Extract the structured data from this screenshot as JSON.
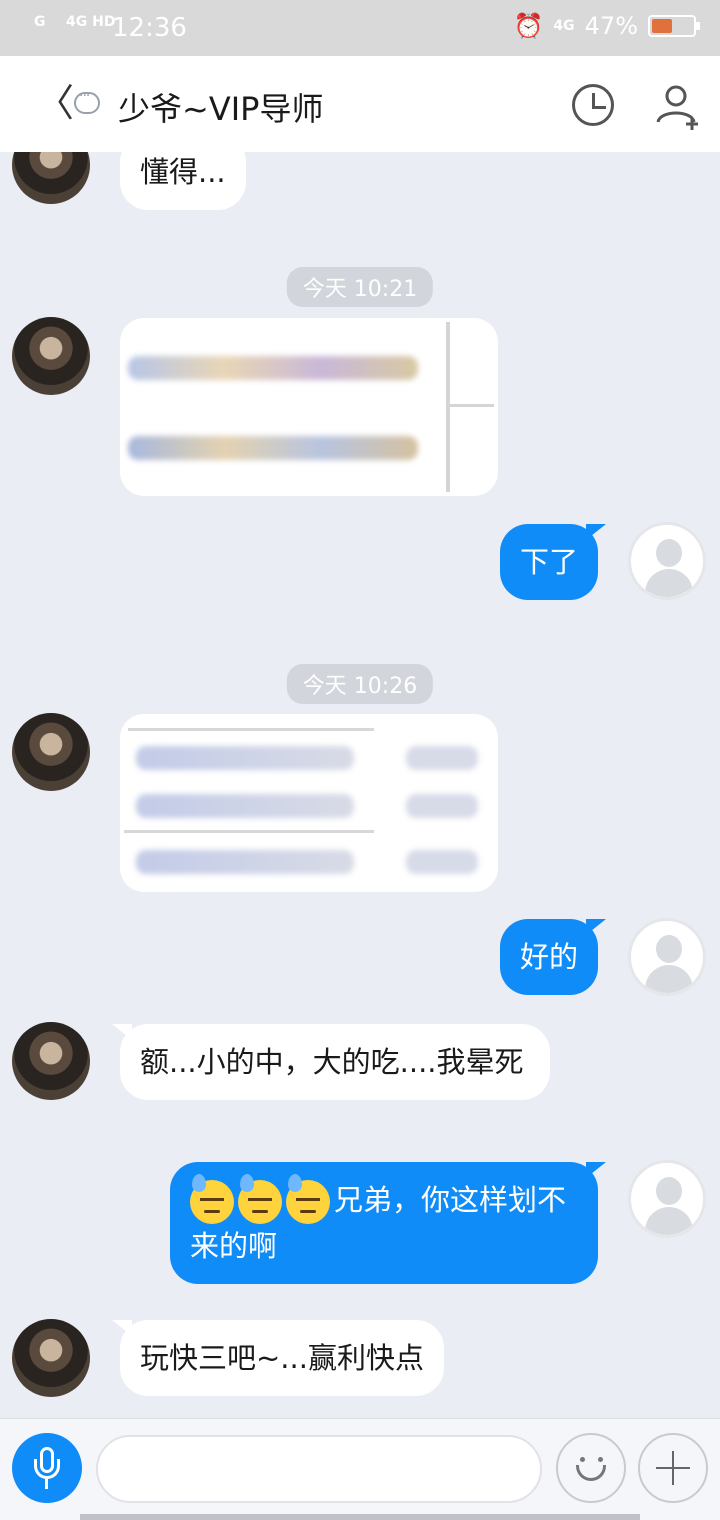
{
  "status_bar": {
    "signal_1": "G",
    "signal_2": "4G HD",
    "time": "12:36",
    "network": "4G",
    "battery": "47%"
  },
  "nav": {
    "title": "少爷~VIP导师"
  },
  "messages": [
    {
      "text": "懂得..."
    },
    {
      "timestamp": "今天 10:21"
    },
    {
      "text": "下了"
    },
    {
      "timestamp": "今天 10:26"
    },
    {
      "text": "好的"
    },
    {
      "text": "额...小的中，大的吃....我晕死"
    },
    {
      "text": "兄弟，你这样划不来的啊"
    },
    {
      "text": "玩快三吧~...赢利快点"
    }
  ],
  "input": {
    "value": ""
  },
  "colors": {
    "accent": "#0f8cf7",
    "background": "#eaedf4"
  }
}
